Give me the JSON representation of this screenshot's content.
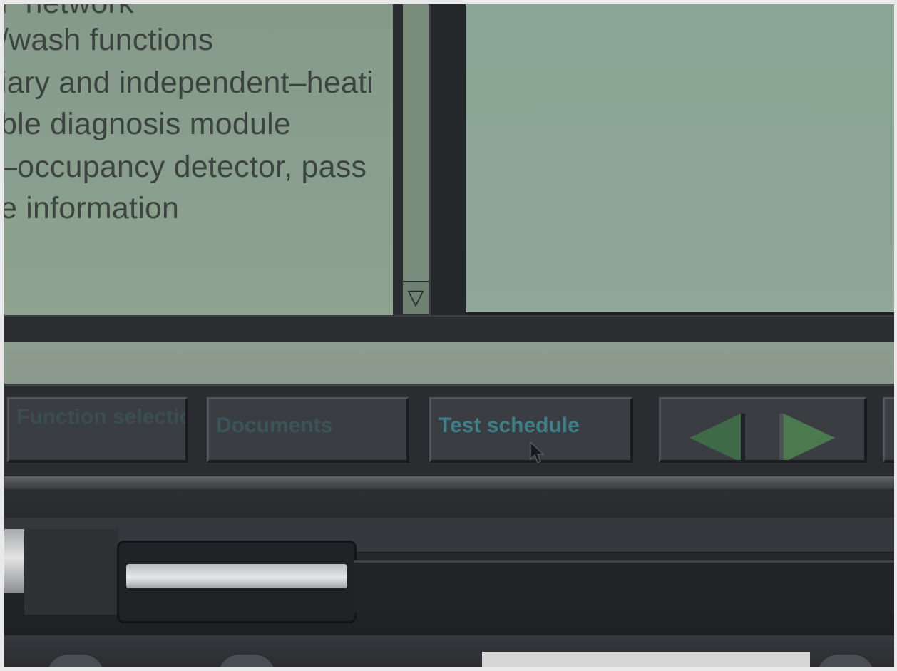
{
  "function_list": {
    "items": [
      "Г network",
      "/wash functions",
      "iary and independent–heati",
      "ble diagnosis module",
      "–occupancy detector, pass",
      "e information"
    ]
  },
  "scrollbar": {
    "down_arrow_glyph": "▽"
  },
  "toolbar": {
    "function_selection_label": "Function selection",
    "documents_label": "Documents",
    "test_schedule_label": "Test schedule",
    "nav_back_icon": "triangle-left",
    "nav_forward_icon": "triangle-right"
  },
  "colors": {
    "screen_bg": "#8a9e8d",
    "frame": "#2a2d30",
    "button_text": "#4a8a8c",
    "nav_arrow": "#4a7a4e"
  }
}
